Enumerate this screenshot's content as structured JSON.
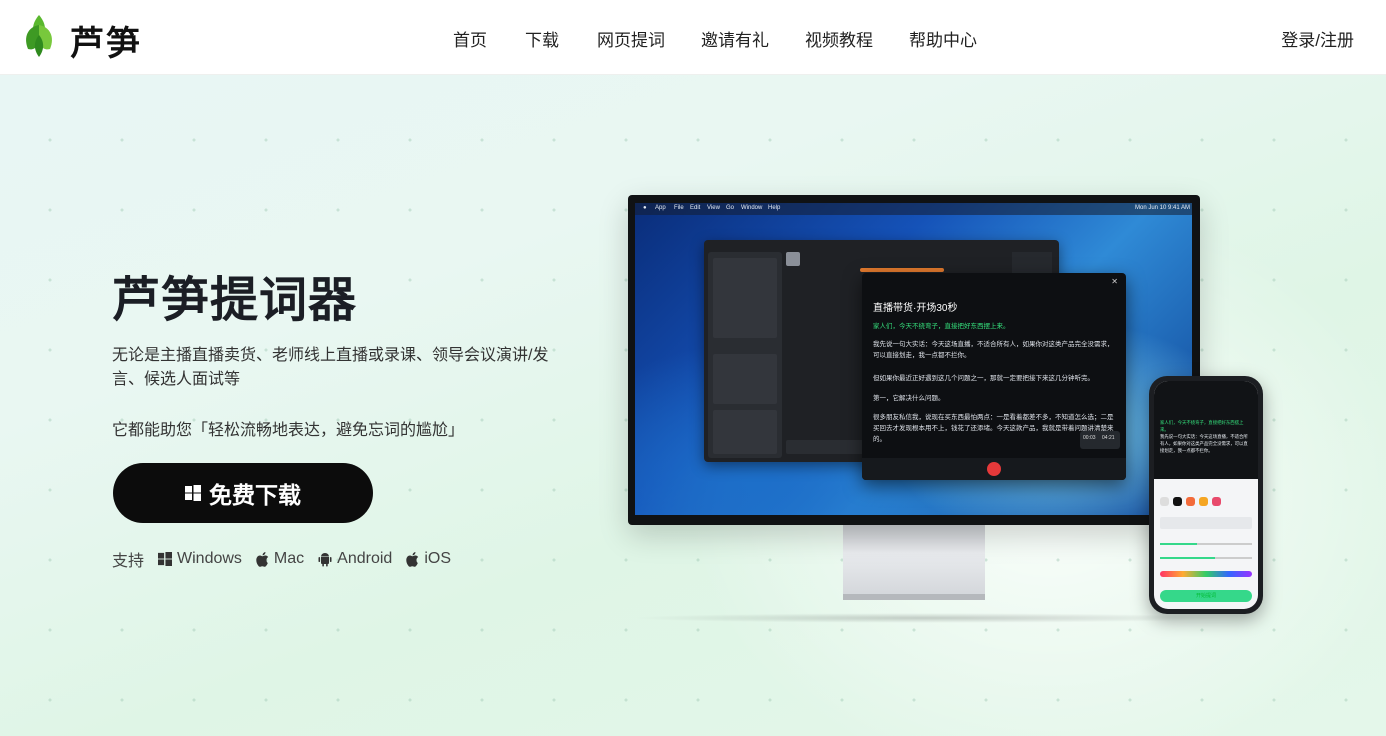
{
  "header": {
    "brand": "芦笋",
    "nav": [
      "首页",
      "下载",
      "网页提词",
      "邀请有礼",
      "视频教程",
      "帮助中心"
    ],
    "login": "登录/注册"
  },
  "hero": {
    "title": "芦笋提词器",
    "description": "无论是主播直播卖货、老师线上直播或录课、领导会议演讲/发言、候选人面试等",
    "tagline": "它都能助您「轻松流畅地表达，避免忘词的尴尬」",
    "download_label": "免费下载",
    "support_label": "支持",
    "platforms": [
      "Windows",
      "Mac",
      "Android",
      "iOS"
    ]
  },
  "mockup": {
    "menubar": [
      "App",
      "File",
      "Edit",
      "View",
      "Go",
      "Window",
      "Help"
    ],
    "clock": "Mon Jun 10 9:41 AM",
    "prompter_title": "直播带货·开场30秒",
    "prompter_lines": [
      "家人们，今天不绕弯子，直接把好东西摆上来。",
      "我先说一句大实话：今天这场直播，不适合所有人，如果你对这类产品完全没需求，可以直接划走，我一点都不拦你。",
      "但如果你最近正好遇到这几个问题之一，那就一定要把接下来这几分钟听完。",
      "第一，它解决什么问题。",
      "很多朋友私信我，说现在买东西最怕两点：一是看着都差不多，不知道怎么选；二是买回去才发现根本用不上，钱花了还添堵。今天这款产品，我就是带着问题讲清楚来的。"
    ],
    "timer_a": "00:03",
    "timer_b": "04:21",
    "phone_button": "开始提词"
  }
}
